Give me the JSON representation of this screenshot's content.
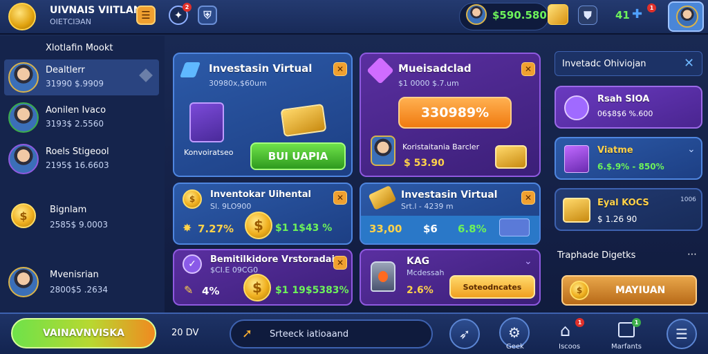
{
  "header": {
    "app_name": "UIVNAIS VIITLAN",
    "app_subtitle": "ОIETСIЭАN",
    "balance": "$590.580r",
    "currency_badge_count": "2",
    "level_value": "41",
    "level_badge": "1",
    "icons": [
      "coin-stack-icon",
      "menu-icon",
      "notification-icon",
      "shield-icon",
      "wallet-icon",
      "shield-rank-icon",
      "gamepad-icon",
      "profile-icon"
    ]
  },
  "sidebar": {
    "title": "Xlotlafin Mookt",
    "items": [
      {
        "name": "Dealtlerr",
        "value": "31990 $.9909"
      },
      {
        "name": "Aonilen Ivaco",
        "value": "3193$ 2.5560"
      },
      {
        "name": "Roels Stigeool",
        "value": "2195$ 16.6603"
      },
      {
        "name": "Bignlam",
        "value": "2585$ 9.0003"
      },
      {
        "name": "Mvenisrian",
        "value": "2800$5 .2634"
      }
    ]
  },
  "cards": {
    "c1": {
      "title": "Investasin Virtual",
      "sub": "30980x,$60um",
      "label": "Konvoiratseo",
      "button": "BUI UАРIA"
    },
    "c2": {
      "title": "Mueisadclad",
      "sub": "$1 0000 $.7.um",
      "pct": "330989%",
      "person": "Koristaitania Barcler",
      "amount": "$ 53.90"
    },
    "c3": {
      "title": "Inventokar Uihental",
      "sub": "Sl. 9LO900",
      "pct": "7.27%",
      "amount": "$1 1$43 %"
    },
    "c4": {
      "title": "Investasin Virtual",
      "sub": "Srt.l - 4239 m",
      "a": "33,00",
      "b": "$6",
      "c": "6.8%"
    },
    "c5": {
      "title": "Bemitilkidore Vrstoradai",
      "sub": "$CI.E 09CG0",
      "pct": "4%",
      "amount": "$1 19$5383%"
    },
    "c6": {
      "title": "KAG",
      "sub": "Мсdеssah",
      "pct": "2.6%",
      "button": "Sоtеоdnсаtеs"
    }
  },
  "right": {
    "search": "Invetadc Ohiviojan",
    "items": [
      {
        "title": "Rsah SIOA",
        "value": "06$8$6 %.600"
      },
      {
        "title": "Viatme",
        "value": "6.$.9% - 850%"
      },
      {
        "title": "Eyal KOCS",
        "value": "$ 1.26 90",
        "tag": "1006"
      }
    ],
    "section_title": "Traphade Digetks",
    "section_button": "MAYIUAN"
  },
  "bottom": {
    "main_button": "VAINAVNVISKA",
    "amount": "20 DV",
    "input_text": "Srteeck iatioaand",
    "nav": [
      {
        "label": "",
        "icon": "rocket-icon"
      },
      {
        "label": "Geek",
        "icon": "gear-icon"
      },
      {
        "label": "Iscoos",
        "icon": "home-icon",
        "badge": "1"
      },
      {
        "label": "Marfants",
        "icon": "chart-icon",
        "badge": "1"
      },
      {
        "label": "",
        "icon": "menu-icon"
      }
    ]
  },
  "colors": {
    "accent_gold": "#ffd24a",
    "accent_green": "#6df25a",
    "panel_blue": "#2c5aa8",
    "panel_purple": "#5a2fa0"
  }
}
